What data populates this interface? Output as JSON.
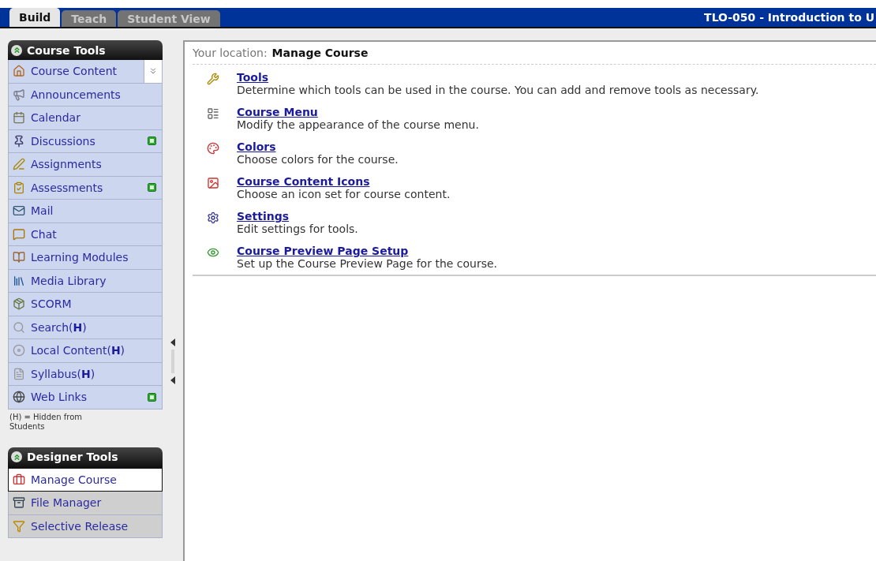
{
  "tabs": [
    {
      "label": "Build",
      "selected": true
    },
    {
      "label": "Teach",
      "selected": false
    },
    {
      "label": "Student View",
      "selected": false
    }
  ],
  "course_title": "TLO-050 - Introduction to U",
  "sidebar": {
    "sections": [
      {
        "title": "Course Tools",
        "kind": "course",
        "items": [
          {
            "label": "Course Content",
            "flag": false,
            "selected": false,
            "expander": true
          },
          {
            "label": "Announcements",
            "flag": false,
            "selected": false
          },
          {
            "label": "Calendar",
            "flag": false,
            "selected": false
          },
          {
            "label": "Discussions",
            "flag": true,
            "selected": false
          },
          {
            "label": "Assignments",
            "flag": false,
            "selected": false
          },
          {
            "label": "Assessments",
            "flag": true,
            "selected": false
          },
          {
            "label": "Mail",
            "flag": false,
            "selected": false
          },
          {
            "label": "Chat",
            "flag": false,
            "selected": false
          },
          {
            "label": "Learning Modules",
            "flag": false,
            "selected": false
          },
          {
            "label": "Media Library",
            "flag": false,
            "selected": false
          },
          {
            "label": "SCORM",
            "flag": false,
            "selected": false
          },
          {
            "label": "Search(**H**)",
            "flag": false,
            "selected": false
          },
          {
            "label": "Local Content(**H**)",
            "flag": false,
            "selected": false
          },
          {
            "label": "Syllabus(**H**)",
            "flag": false,
            "selected": false
          },
          {
            "label": "Web Links",
            "flag": true,
            "selected": false
          }
        ],
        "note": "(H) = Hidden from Students"
      },
      {
        "title": "Designer Tools",
        "kind": "designer",
        "items": [
          {
            "label": "Manage Course",
            "flag": false,
            "selected": true
          },
          {
            "label": "File Manager",
            "flag": false,
            "selected": false
          },
          {
            "label": "Selective Release",
            "flag": false,
            "selected": false
          }
        ]
      }
    ]
  },
  "location": {
    "label": "Your location:",
    "value": "Manage Course"
  },
  "tools": [
    {
      "title": "Tools",
      "description": "Determine which tools can be used in the course. You can add and remove tools as necessary."
    },
    {
      "title": "Course Menu",
      "description": "Modify the appearance of the course menu."
    },
    {
      "title": "Colors",
      "description": "Choose colors for the course."
    },
    {
      "title": "Course Content Icons",
      "description": "Choose an icon set for course content."
    },
    {
      "title": "Settings",
      "description": "Edit settings for tools."
    },
    {
      "title": "Course Preview Page Setup",
      "description": "Set up the Course Preview Page for the course."
    }
  ]
}
